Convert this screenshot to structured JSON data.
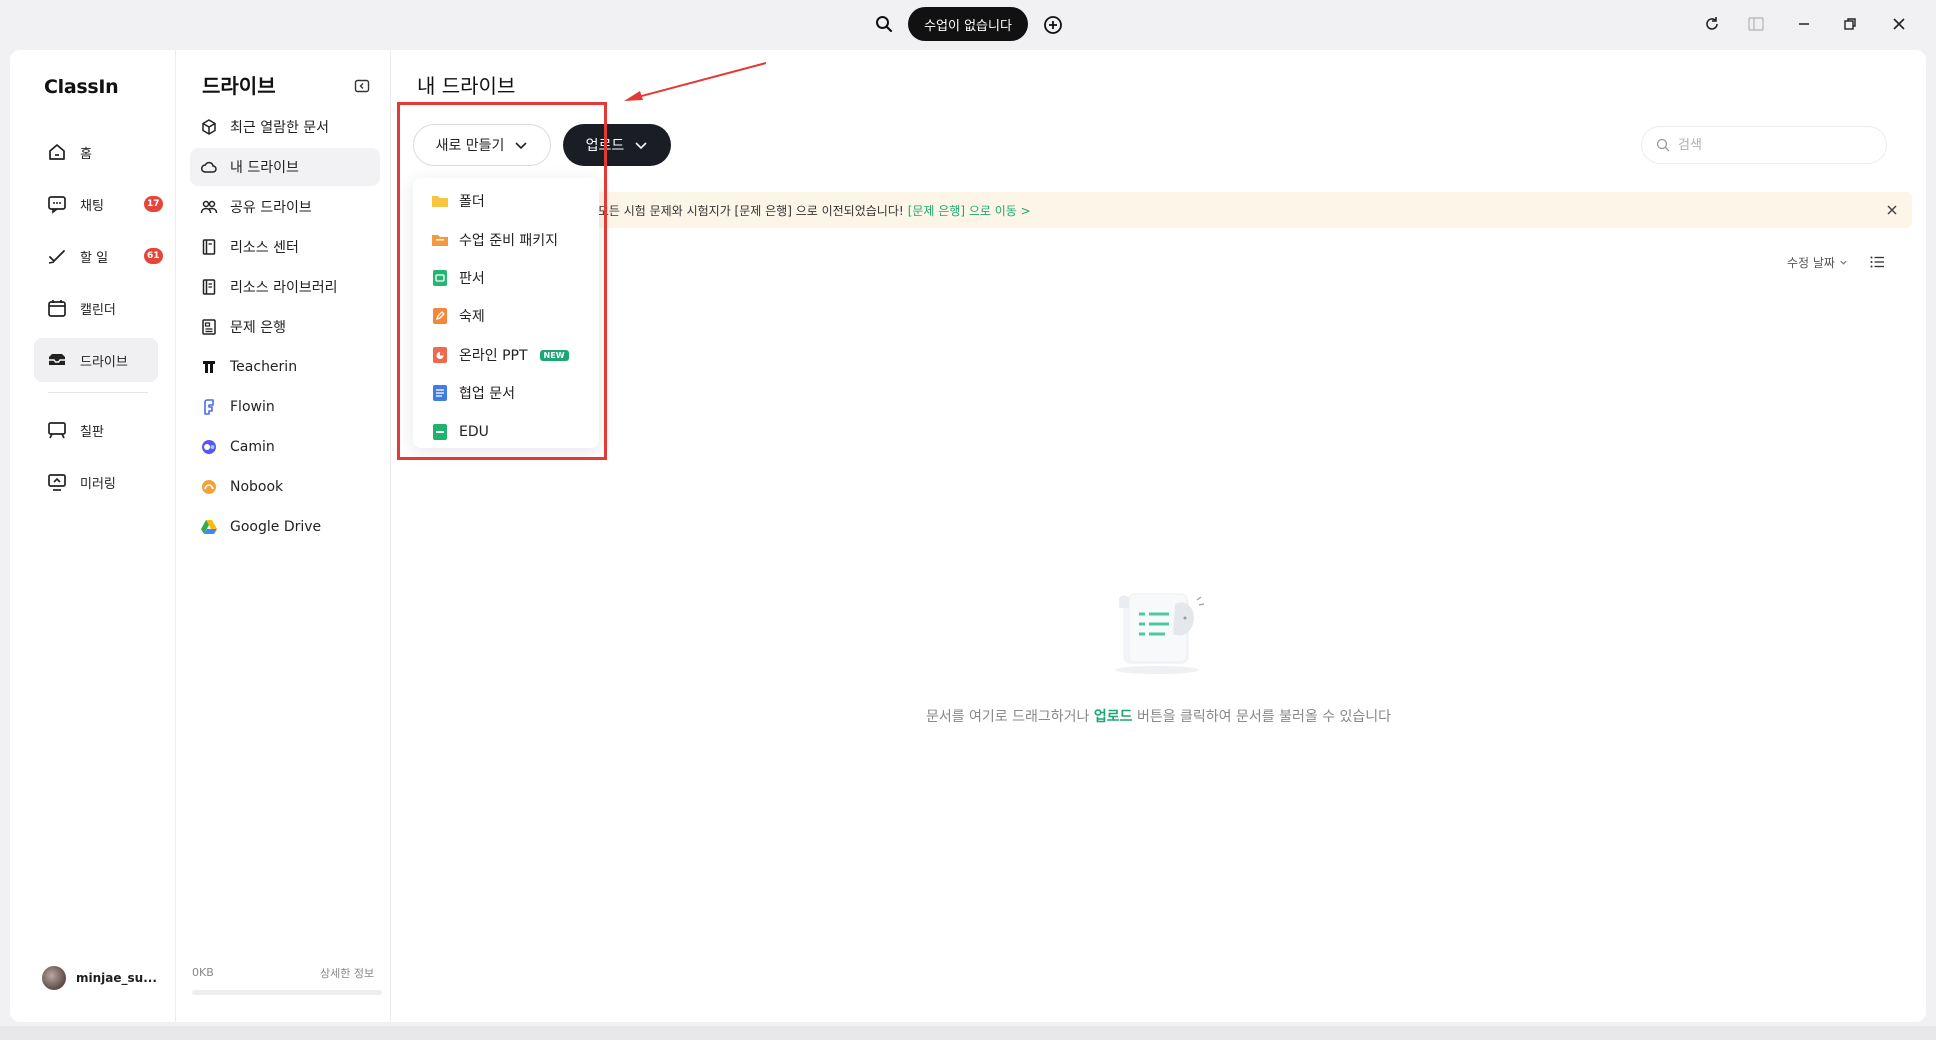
{
  "topbar": {
    "class_status": "수업이 없습니다"
  },
  "nav": {
    "logo": "ClassIn",
    "items": [
      {
        "label": "홈"
      },
      {
        "label": "채팅",
        "badge": "17"
      },
      {
        "label": "할 일",
        "badge": "61"
      },
      {
        "label": "캘린더"
      },
      {
        "label": "드라이브"
      },
      {
        "label": "칠판"
      },
      {
        "label": "미러링"
      }
    ],
    "user": "minjae_su..."
  },
  "drive": {
    "title": "드라이브",
    "items": [
      {
        "label": "최근 열람한 문서"
      },
      {
        "label": "내 드라이브"
      },
      {
        "label": "공유 드라이브"
      },
      {
        "label": "리소스 센터"
      },
      {
        "label": "리소스 라이브러리"
      },
      {
        "label": "문제 은행"
      },
      {
        "label": "Teacherin"
      },
      {
        "label": "Flowin"
      },
      {
        "label": "Camin"
      },
      {
        "label": "Nobook"
      },
      {
        "label": "Google Drive"
      }
    ],
    "storage_used": "0KB",
    "storage_detail": "상세한 정보"
  },
  "content": {
    "title": "내 드라이브",
    "new_label": "새로 만들기",
    "upload_label": "업로드",
    "search_placeholder": "검색",
    "notice_text": "는 모든 시험 문제와 시험지가 [문제 은행] 으로 이전되었습니다!",
    "notice_link": "[문제 은행] 으로 이동 >",
    "sort_label": "수정 날짜",
    "empty_prefix": "문서를 여기로 드래그하거나 ",
    "empty_highlight": "업로드",
    "empty_suffix": " 버튼을 클릭하여 문서를 불러올 수 있습니다"
  },
  "dropdown": {
    "items": [
      {
        "label": "폴더",
        "color": "#f7c540"
      },
      {
        "label": "수업 준비 패키지",
        "color": "#f59a3c"
      },
      {
        "label": "판서",
        "color": "#22b573"
      },
      {
        "label": "숙제",
        "color": "#f5873c"
      },
      {
        "label": "온라인 PPT",
        "color": "#ee6a4d",
        "badge": "NEW"
      },
      {
        "label": "협업 문서",
        "color": "#3f7ce6"
      },
      {
        "label": "EDU",
        "color": "#1fb36b"
      }
    ]
  },
  "colors": {
    "accent": "#1ca772",
    "annotation": "#e53935"
  }
}
